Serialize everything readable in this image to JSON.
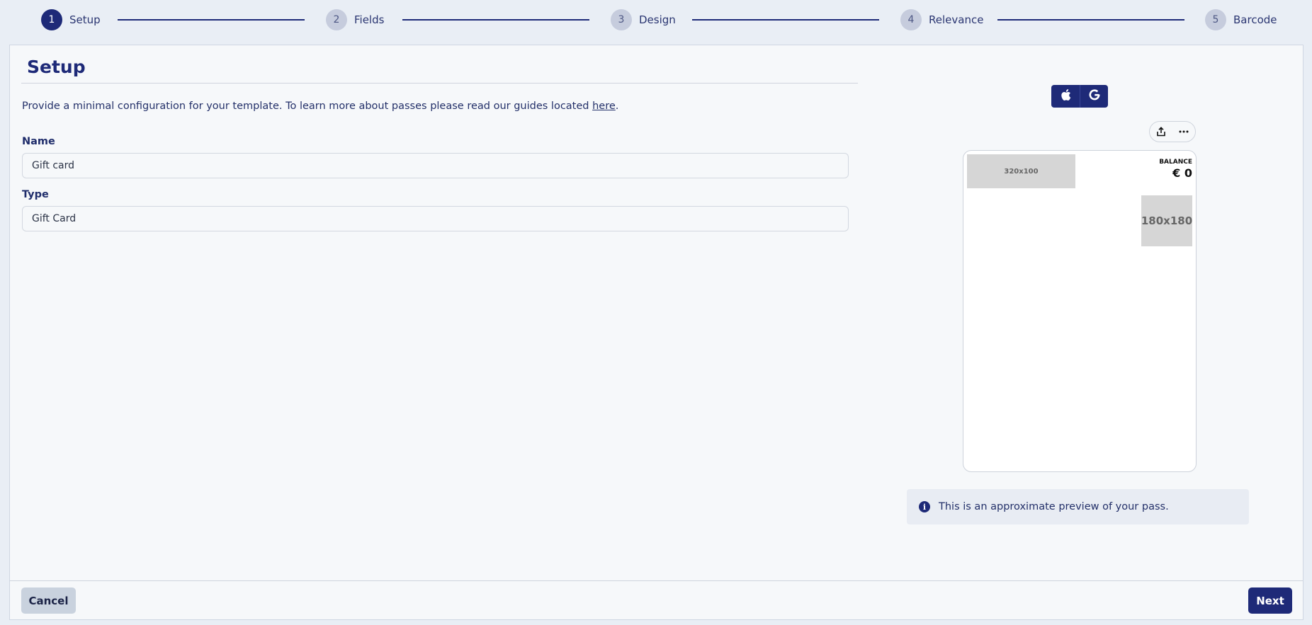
{
  "stepper": {
    "steps": [
      {
        "number": "1",
        "label": "Setup"
      },
      {
        "number": "2",
        "label": "Fields"
      },
      {
        "number": "3",
        "label": "Design"
      },
      {
        "number": "4",
        "label": "Relevance"
      },
      {
        "number": "5",
        "label": "Barcode"
      }
    ],
    "active_step": 1
  },
  "page": {
    "title": "Setup",
    "intro_text": "Provide a minimal configuration for your template. To learn more about passes please read our guides located ",
    "intro_link": "here",
    "intro_suffix": "."
  },
  "form": {
    "name_label": "Name",
    "name_value": "Gift card",
    "type_label": "Type",
    "type_value": "Gift Card"
  },
  "preview": {
    "platforms": [
      {
        "name": "apple",
        "icon": "apple-icon"
      },
      {
        "name": "google",
        "icon": "google-icon"
      }
    ],
    "actions": [
      {
        "icon": "share-icon"
      },
      {
        "icon": "more-icon"
      }
    ],
    "pass": {
      "logo_placeholder": "320x100",
      "thumbnail_placeholder": "180x180",
      "balance_label": "BALANCE",
      "balance_value": "€ 0"
    },
    "info_icon": "info-icon",
    "info_text": "This is an approximate preview of your pass."
  },
  "footer": {
    "cancel_label": "Cancel",
    "next_label": "Next"
  },
  "colors": {
    "primary": "#1e2a78",
    "background": "#e9eef5",
    "card": "#f6f8fa",
    "step_inactive": "#c6ccdd",
    "cancel_button": "#c9d2de"
  }
}
